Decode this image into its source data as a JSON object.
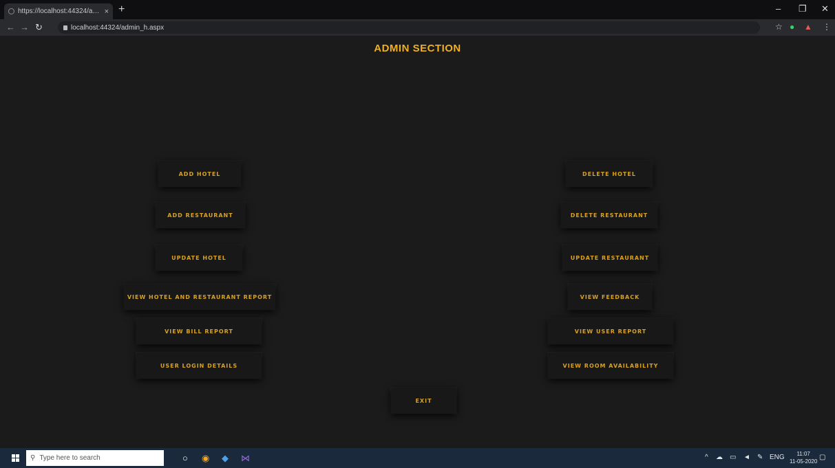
{
  "browser": {
    "tab_title": "https://localhost:44324/admin_h...",
    "tab_close": "×",
    "new_tab": "+",
    "url": "localhost:44324/admin_h.aspx",
    "minimize": "–",
    "restore": "❐",
    "close": "✕"
  },
  "page": {
    "title": "ADMIN SECTION",
    "left_buttons": [
      "ADD HOTEL",
      "ADD RESTAURANT",
      "UPDATE HOTEL",
      "VIEW HOTEL AND RESTAURANT REPORT",
      "VIEW BILL REPORT",
      "USER LOGIN DETAILS"
    ],
    "right_buttons": [
      "DELETE HOTEL",
      "DELETE RESTAURANT",
      "UPDATE RESTAURANT",
      "VIEW FEEDBACK",
      "VIEW USER REPORT",
      "VIEW ROOM AVAILABILITY"
    ],
    "exit_button": "EXIT"
  },
  "taskbar": {
    "search_placeholder": "Type here to search",
    "lang": "ENG",
    "time": "11:07",
    "date": "11-05-2020"
  },
  "colors": {
    "accent": "#f0b020",
    "background": "#1b1b1b"
  }
}
